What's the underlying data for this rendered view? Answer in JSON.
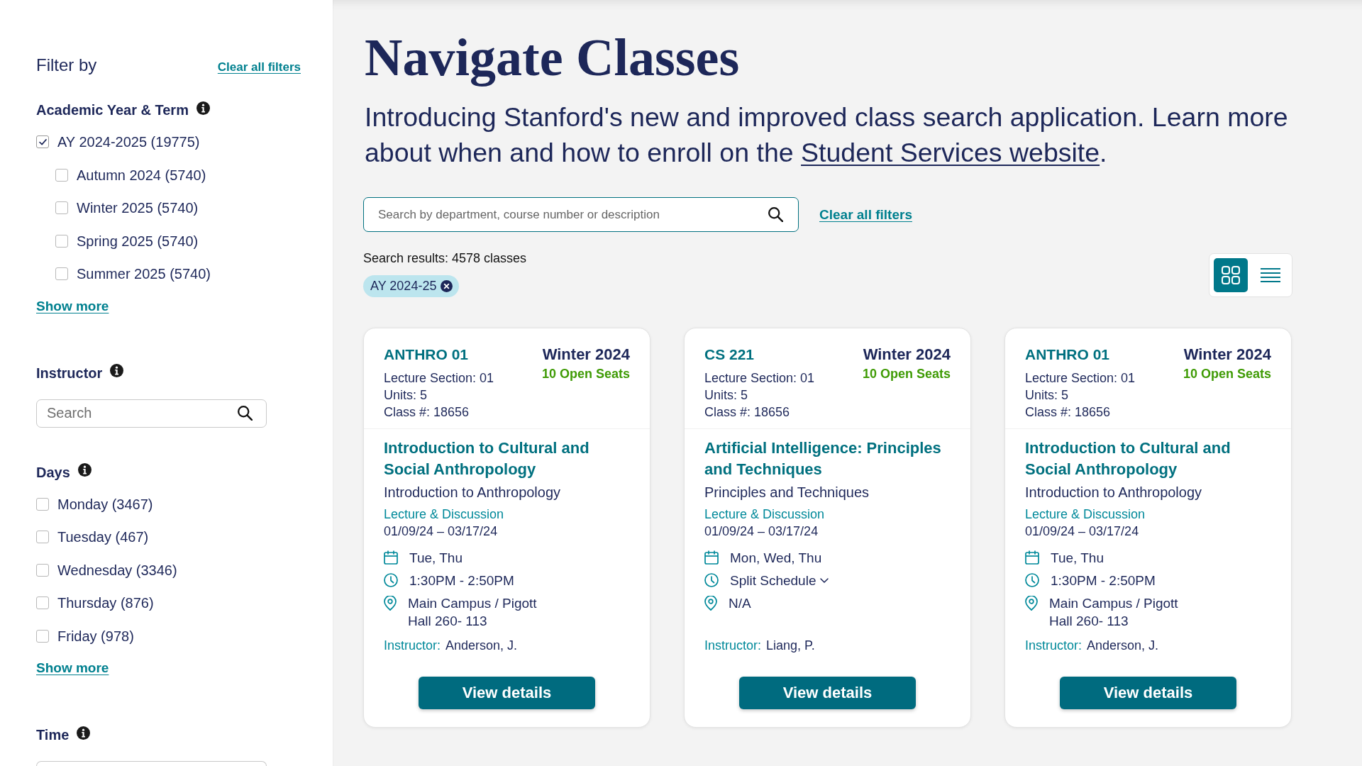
{
  "sidebar": {
    "heading": "Filter by",
    "clear_link": "Clear all filters",
    "sections": [
      {
        "kind": "checklist",
        "title": "Academic Year & Term",
        "options": [
          {
            "label": "AY 2024-2025 (19775)",
            "checked": true,
            "children": [
              {
                "label": "Autumn 2024 (5740)",
                "checked": false
              },
              {
                "label": "Winter 2025 (5740)",
                "checked": false
              },
              {
                "label": "Spring 2025 (5740)",
                "checked": false
              },
              {
                "label": "Summer 2025 (5740)",
                "checked": false
              }
            ]
          }
        ],
        "show_more": "Show more"
      },
      {
        "kind": "search",
        "title": "Instructor",
        "placeholder": "Search"
      },
      {
        "kind": "checklist",
        "title": "Days",
        "options": [
          {
            "label": "Monday (3467)",
            "checked": false
          },
          {
            "label": "Tuesday (467)",
            "checked": false
          },
          {
            "label": "Wednesday (3346)",
            "checked": false
          },
          {
            "label": "Thursday (876)",
            "checked": false
          },
          {
            "label": "Friday (978)",
            "checked": false
          }
        ],
        "show_more": "Show more"
      },
      {
        "kind": "field",
        "title": "Time"
      }
    ]
  },
  "main": {
    "title": "Navigate Classes",
    "intro": {
      "text": "Introducing Stanford's new and improved class search application. Learn more about when and how to enroll on the ",
      "link": "Student Services website",
      "after": "."
    },
    "search": {
      "placeholder": "Search by department, course number or description"
    },
    "clear_link": "Clear all filters",
    "results": "Search results: 4578 classes",
    "chips": [
      {
        "label": "AY 2024-25"
      }
    ],
    "view_toggle": [
      {
        "kind": "grid",
        "selected": true
      },
      {
        "kind": "list",
        "selected": false
      }
    ],
    "cards": [
      {
        "code": "ANTHRO 01",
        "term": "Winter 2024",
        "seats": "10 Open Seats",
        "section": "Lecture Section: 01",
        "units": "Units: 5",
        "class_number": "Class #: 18656",
        "title": "Introduction to Cultural and Social Anthropology",
        "subtitle": "Introduction to Anthropology",
        "format": "Lecture & Discussion",
        "dates": "01/09/24 – 03/17/24",
        "days": "Tue, Thu",
        "time": {
          "text": "1:30PM - 2:50PM"
        },
        "location": "Main Campus / Pigott Hall 260- 113",
        "instructor_label": "Instructor:",
        "instructor": "Anderson, J.",
        "button": "View details"
      },
      {
        "code": "CS 221",
        "term": "Winter 2024",
        "seats": "10 Open Seats",
        "section": "Lecture Section: 01",
        "units": "Units: 5",
        "class_number": "Class #: 18656",
        "title": "Artificial Intelligence: Principles and Techniques",
        "subtitle": "Principles and Techniques",
        "format": "Lecture & Discussion",
        "dates": "01/09/24 – 03/17/24",
        "days": "Mon, Wed, Thu",
        "time": {
          "text": "Split Schedule",
          "expanded": false
        },
        "location": "N/A",
        "instructor_label": "Instructor:",
        "instructor": "Liang, P.",
        "button": "View details"
      },
      {
        "code": "ANTHRO 01",
        "term": "Winter 2024",
        "seats": "10 Open Seats",
        "section": "Lecture Section: 01",
        "units": "Units: 5",
        "class_number": "Class #: 18656",
        "title": "Introduction to Cultural and Social Anthropology",
        "subtitle": "Introduction to Anthropology",
        "format": "Lecture & Discussion",
        "dates": "01/09/24 – 03/17/24",
        "days": "Tue, Thu",
        "time": {
          "text": "1:30PM - 2:50PM"
        },
        "location": "Main Campus / Pigott Hall 260- 113",
        "instructor_label": "Instructor:",
        "instructor": "Anderson, J.",
        "button": "View details"
      }
    ]
  }
}
